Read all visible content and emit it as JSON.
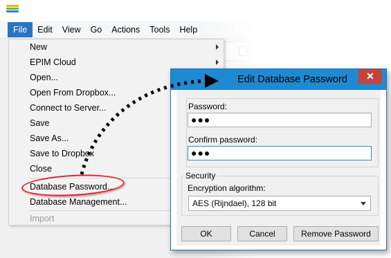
{
  "menubar": {
    "items": [
      "File",
      "Edit",
      "View",
      "Go",
      "Actions",
      "Tools",
      "Help"
    ],
    "active_index": 0
  },
  "file_menu": {
    "items": [
      {
        "label": "New",
        "has_submenu": true,
        "enabled": true
      },
      {
        "label": "EPIM Cloud",
        "has_submenu": true,
        "enabled": true
      },
      {
        "label": "Open...",
        "has_submenu": false,
        "enabled": true
      },
      {
        "label": "Open From Dropbox...",
        "has_submenu": false,
        "enabled": true
      },
      {
        "label": "Connect to Server...",
        "has_submenu": false,
        "enabled": true
      },
      {
        "label": "Save",
        "has_submenu": false,
        "enabled": true
      },
      {
        "label": "Save As...",
        "has_submenu": false,
        "enabled": true
      },
      {
        "label": "Save to Dropbox",
        "has_submenu": false,
        "enabled": true
      },
      {
        "label": "Close",
        "has_submenu": false,
        "enabled": true
      },
      {
        "label": "Database Password...",
        "has_submenu": false,
        "enabled": true,
        "highlighted": true
      },
      {
        "label": "Database Management...",
        "has_submenu": false,
        "enabled": true
      },
      {
        "label": "Import",
        "has_submenu": false,
        "enabled": false
      }
    ]
  },
  "dialog": {
    "title": "Edit Database Password",
    "close_glyph": "✕",
    "password_label": "Password:",
    "password_value": "●●●",
    "confirm_label": "Confirm password:",
    "confirm_value": "●●●",
    "security_title": "Security",
    "algorithm_label": "Encryption algorithm:",
    "algorithm_value": "AES (Rijndael), 128 bit",
    "ok_label": "OK",
    "cancel_label": "Cancel",
    "remove_label": "Remove Password"
  },
  "colors": {
    "menu_active": "#2a74c4",
    "dialog_titlebar": "#1f8ad2",
    "close_button": "#c7433a",
    "highlight_ellipse": "#d9262c"
  }
}
